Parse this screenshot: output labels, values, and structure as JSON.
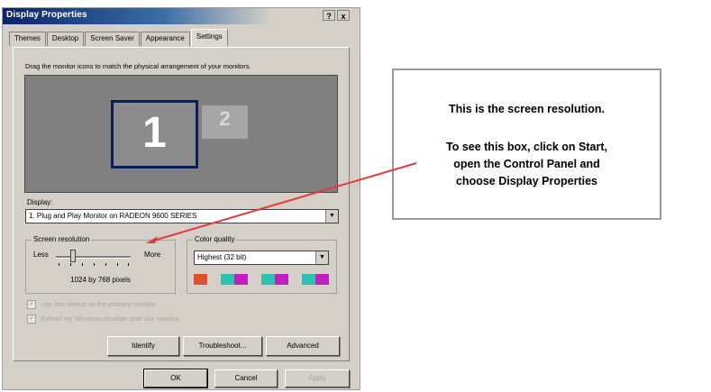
{
  "window": {
    "title": "Display Properties",
    "help_button": "?",
    "close_button": "x"
  },
  "tabs": [
    "Themes",
    "Desktop",
    "Screen Saver",
    "Appearance",
    "Settings"
  ],
  "active_tab": "Settings",
  "settings": {
    "instruction": "Drag the monitor icons to match the physical arrangement of your monitors.",
    "monitors": [
      "1",
      "2"
    ],
    "display_label": "Display:",
    "display_value": "1. Plug and Play Monitor on RADEON 9600 SERIES",
    "resolution": {
      "group_label": "Screen resolution",
      "less": "Less",
      "more": "More",
      "value": "1024 by 768 pixels"
    },
    "color_quality": {
      "group_label": "Color quality",
      "value": "Highest (32 bit)",
      "swatches": [
        "#e05030",
        "#d4d0c8",
        "#30c0b0",
        "#c020c0",
        "#d4d0c8",
        "#30c0b0",
        "#c020c0",
        "#d4d0c8",
        "#30c0b0",
        "#c020c0"
      ]
    },
    "checkbox_primary": "Use this device as the primary monitor",
    "checkbox_extend": "Extend my Windows desktop onto this monitor",
    "buttons": {
      "identify": "Identify",
      "troubleshoot": "Troubleshoot...",
      "advanced": "Advanced"
    }
  },
  "dialog_buttons": {
    "ok": "OK",
    "cancel": "Cancel",
    "apply": "Apply"
  },
  "callout": {
    "line1": "This is the screen resolution.",
    "line2": [
      "To see this box, click on Start,",
      "open the Control Panel and",
      "choose Display Properties"
    ]
  },
  "colors": {
    "titlebar": "#0a246a",
    "dialog_bg": "#d4d0c8",
    "arrow": "#e23b3b"
  }
}
